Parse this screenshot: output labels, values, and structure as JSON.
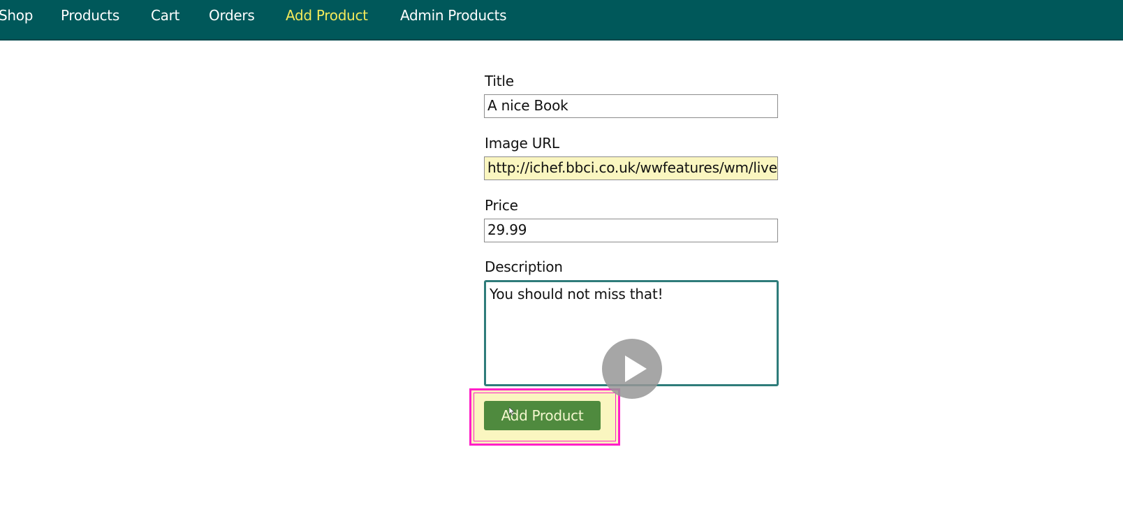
{
  "nav": {
    "items": [
      {
        "label": "Shop",
        "active": false
      },
      {
        "label": "Products",
        "active": false
      },
      {
        "label": "Cart",
        "active": false
      },
      {
        "label": "Orders",
        "active": false
      },
      {
        "label": "Add Product",
        "active": true
      },
      {
        "label": "Admin Products",
        "active": false
      }
    ]
  },
  "form": {
    "title_label": "Title",
    "title_value": "A nice Book",
    "image_label": "Image URL",
    "image_value": "http://ichef.bbci.co.uk/wwfeatures/wm/live",
    "price_label": "Price",
    "price_value": "29.99",
    "description_label": "Description",
    "description_value": "You should not miss that!",
    "submit_label": "Add Product"
  },
  "overlay": {
    "video_icon": "play-icon"
  },
  "colors": {
    "nav_bg": "#00585a",
    "nav_active": "#f4ea5b",
    "button_bg": "#4f8a3e",
    "highlight_border": "#ff1fc8",
    "autofill_bg": "#faf6c0"
  }
}
